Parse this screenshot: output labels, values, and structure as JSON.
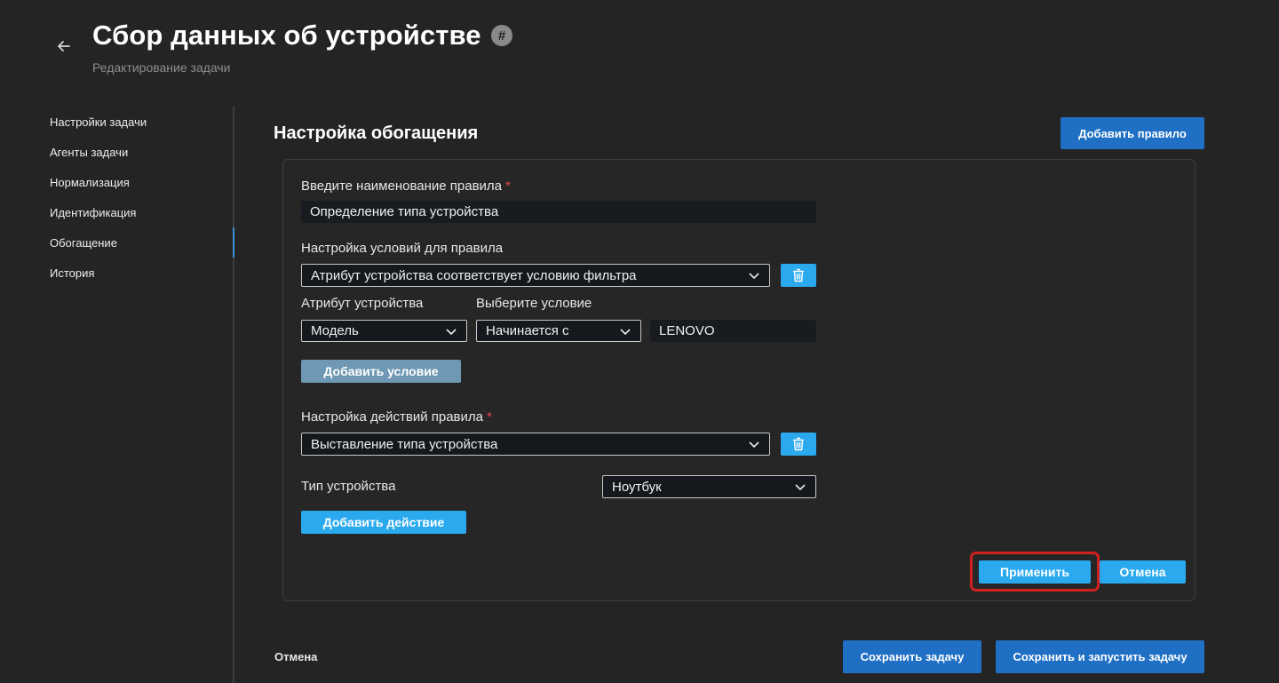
{
  "header": {
    "title": "Сбор данных об устройстве",
    "hash_badge": "#",
    "subtitle": "Редактирование задачи"
  },
  "sidebar": {
    "items": [
      {
        "label": "Настройки задачи"
      },
      {
        "label": "Агенты задачи"
      },
      {
        "label": "Нормализация"
      },
      {
        "label": "Идентификация"
      },
      {
        "label": "Обогащение",
        "active": true
      },
      {
        "label": "История"
      }
    ]
  },
  "section": {
    "title": "Настройка обогащения",
    "add_rule_label": "Добавить правило"
  },
  "rule_form": {
    "name_label": "Введите наименование правила",
    "required_mark": "*",
    "name_value": "Определение типа устройства",
    "conditions_label": "Настройка условий для правила",
    "condition_select": "Атрибут устройства соответствует условию фильтра",
    "attribute_label": "Атрибут устройства",
    "attribute_value": "Модель",
    "condition_label": "Выберите условие",
    "condition_value": "Начинается с",
    "filter_value": "LENOVO",
    "add_condition_label": "Добавить условие",
    "actions_label": "Настройка действий правила",
    "action_select": "Выставление типа устройства",
    "device_type_label": "Тип устройства",
    "device_type_value": "Ноутбук",
    "add_action_label": "Добавить действие",
    "apply_label": "Применить",
    "cancel_label": "Отмена"
  },
  "footer": {
    "cancel_label": "Отмена",
    "save_label": "Сохранить задачу",
    "save_run_label": "Сохранить и запустить задачу"
  },
  "colors": {
    "background": "#242424",
    "primary_button": "#1f6fc5",
    "cyan_button": "#2aa9ef",
    "muted_button": "#6e98b3",
    "highlight_border": "#d21f1f",
    "required": "#e5484d"
  }
}
